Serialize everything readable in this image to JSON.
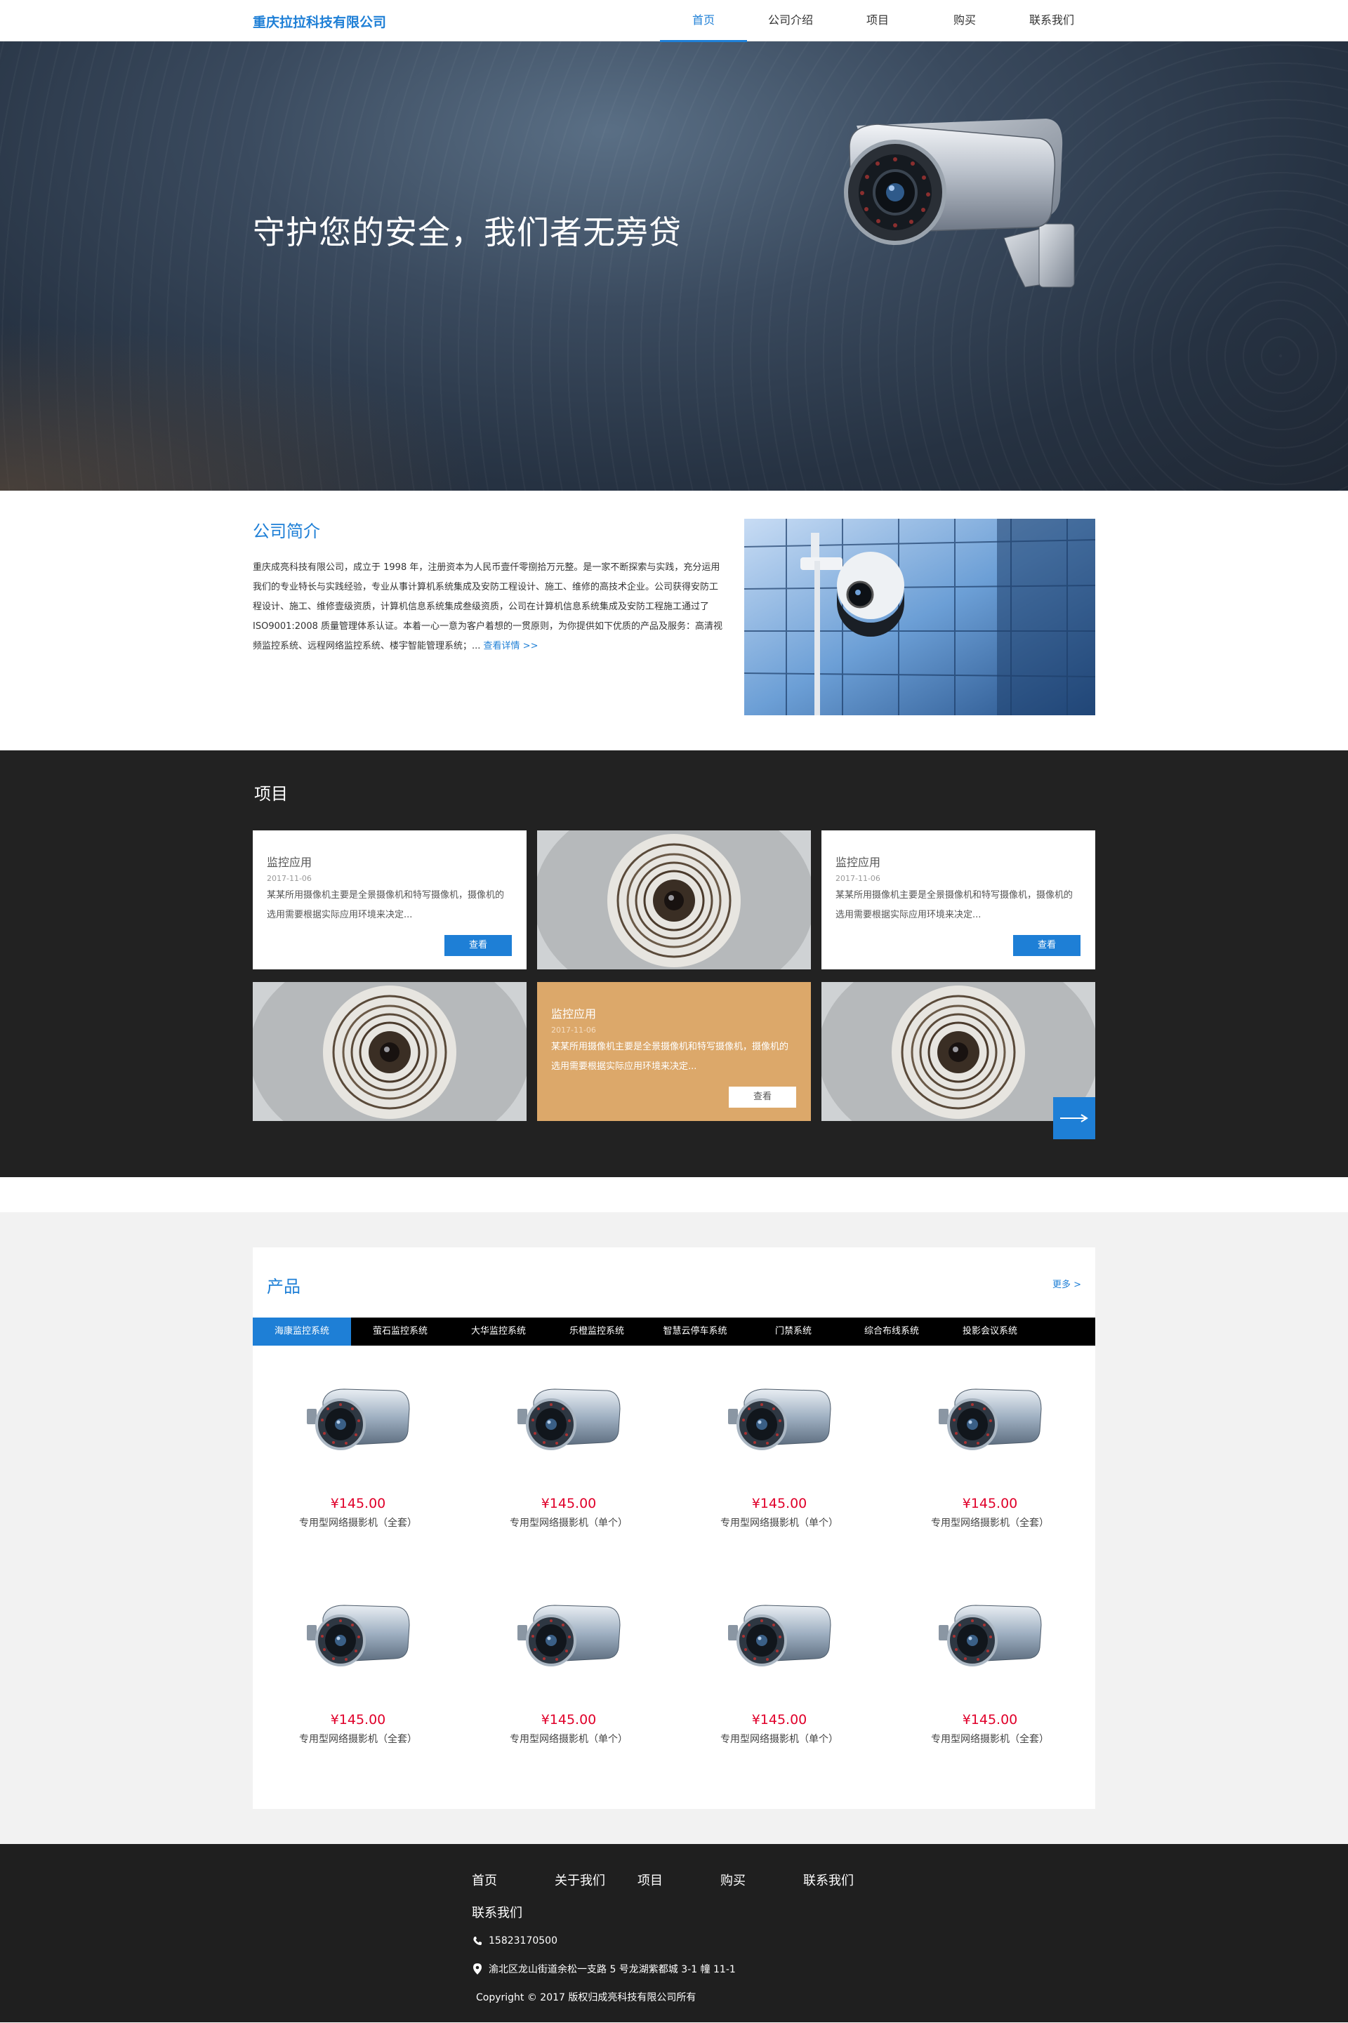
{
  "header": {
    "logo": "重庆拉拉科技有限公司",
    "nav": [
      "首页",
      "公司介绍",
      "项目",
      "购买",
      "联系我们"
    ]
  },
  "banner": {
    "title": "守护您的安全，我们者无旁贷"
  },
  "about": {
    "title": "公司简介",
    "text": "重庆成亮科技有限公司，成立于 1998 年，注册资本为人民币壹仟零捌拾万元整。是一家不断探索与实践，充分运用我们的专业特长与实践经验，专业从事计算机系统集成及安防工程设计、施工、维修的高技术企业。公司获得安防工程设计、施工、维修壹级资质，计算机信息系统集成叁级资质，公司在计算机信息系统集成及安防工程施工通过了 ISO9001:2008 质量管理体系认证。本着一心一意为客户着想的一贯原则，为你提供如下优质的产品及服务：高清视频监控系统、远程网络监控系统、楼宇智能管理系统；...",
    "more": "查看详情 >>"
  },
  "projects": {
    "title": "项目",
    "card": {
      "name": "监控应用",
      "date": "2017-11-06",
      "desc": "某某所用摄像机主要是全景摄像机和特写摄像机，摄像机的选用需要根据实际应用环境来决定...",
      "button": "查看"
    }
  },
  "products": {
    "title": "产品",
    "more": "更多 >",
    "tabs": [
      "海康监控系统",
      "萤石监控系统",
      "大华监控系统",
      "乐橙监控系统",
      "智慧云停车系统",
      "门禁系统",
      "综合布线系统",
      "投影会议系统"
    ],
    "items": [
      {
        "price": "¥145.00",
        "name": "专用型网络摄影机（全套）"
      },
      {
        "price": "¥145.00",
        "name": "专用型网络摄影机（单个）"
      },
      {
        "price": "¥145.00",
        "name": "专用型网络摄影机（单个）"
      },
      {
        "price": "¥145.00",
        "name": "专用型网络摄影机（全套）"
      },
      {
        "price": "¥145.00",
        "name": "专用型网络摄影机（全套）"
      },
      {
        "price": "¥145.00",
        "name": "专用型网络摄影机（单个）"
      },
      {
        "price": "¥145.00",
        "name": "专用型网络摄影机（单个）"
      },
      {
        "price": "¥145.00",
        "name": "专用型网络摄影机（全套）"
      }
    ]
  },
  "footer": {
    "nav": [
      "首页",
      "关于我们",
      "项目",
      "购买",
      "联系我们"
    ],
    "contact_title": "联系我们",
    "phone": "15823170500",
    "address": "渝北区龙山街道余松一支路 5 号龙湖紫都城 3-1 幢 11-1",
    "copyright": "Copyright © 2017  版权归成亮科技有限公司所有"
  },
  "colors": {
    "accent": "#1e7fd6",
    "price": "#e0002a",
    "card_orange": "#dca86a",
    "dark_bg": "#222222"
  }
}
